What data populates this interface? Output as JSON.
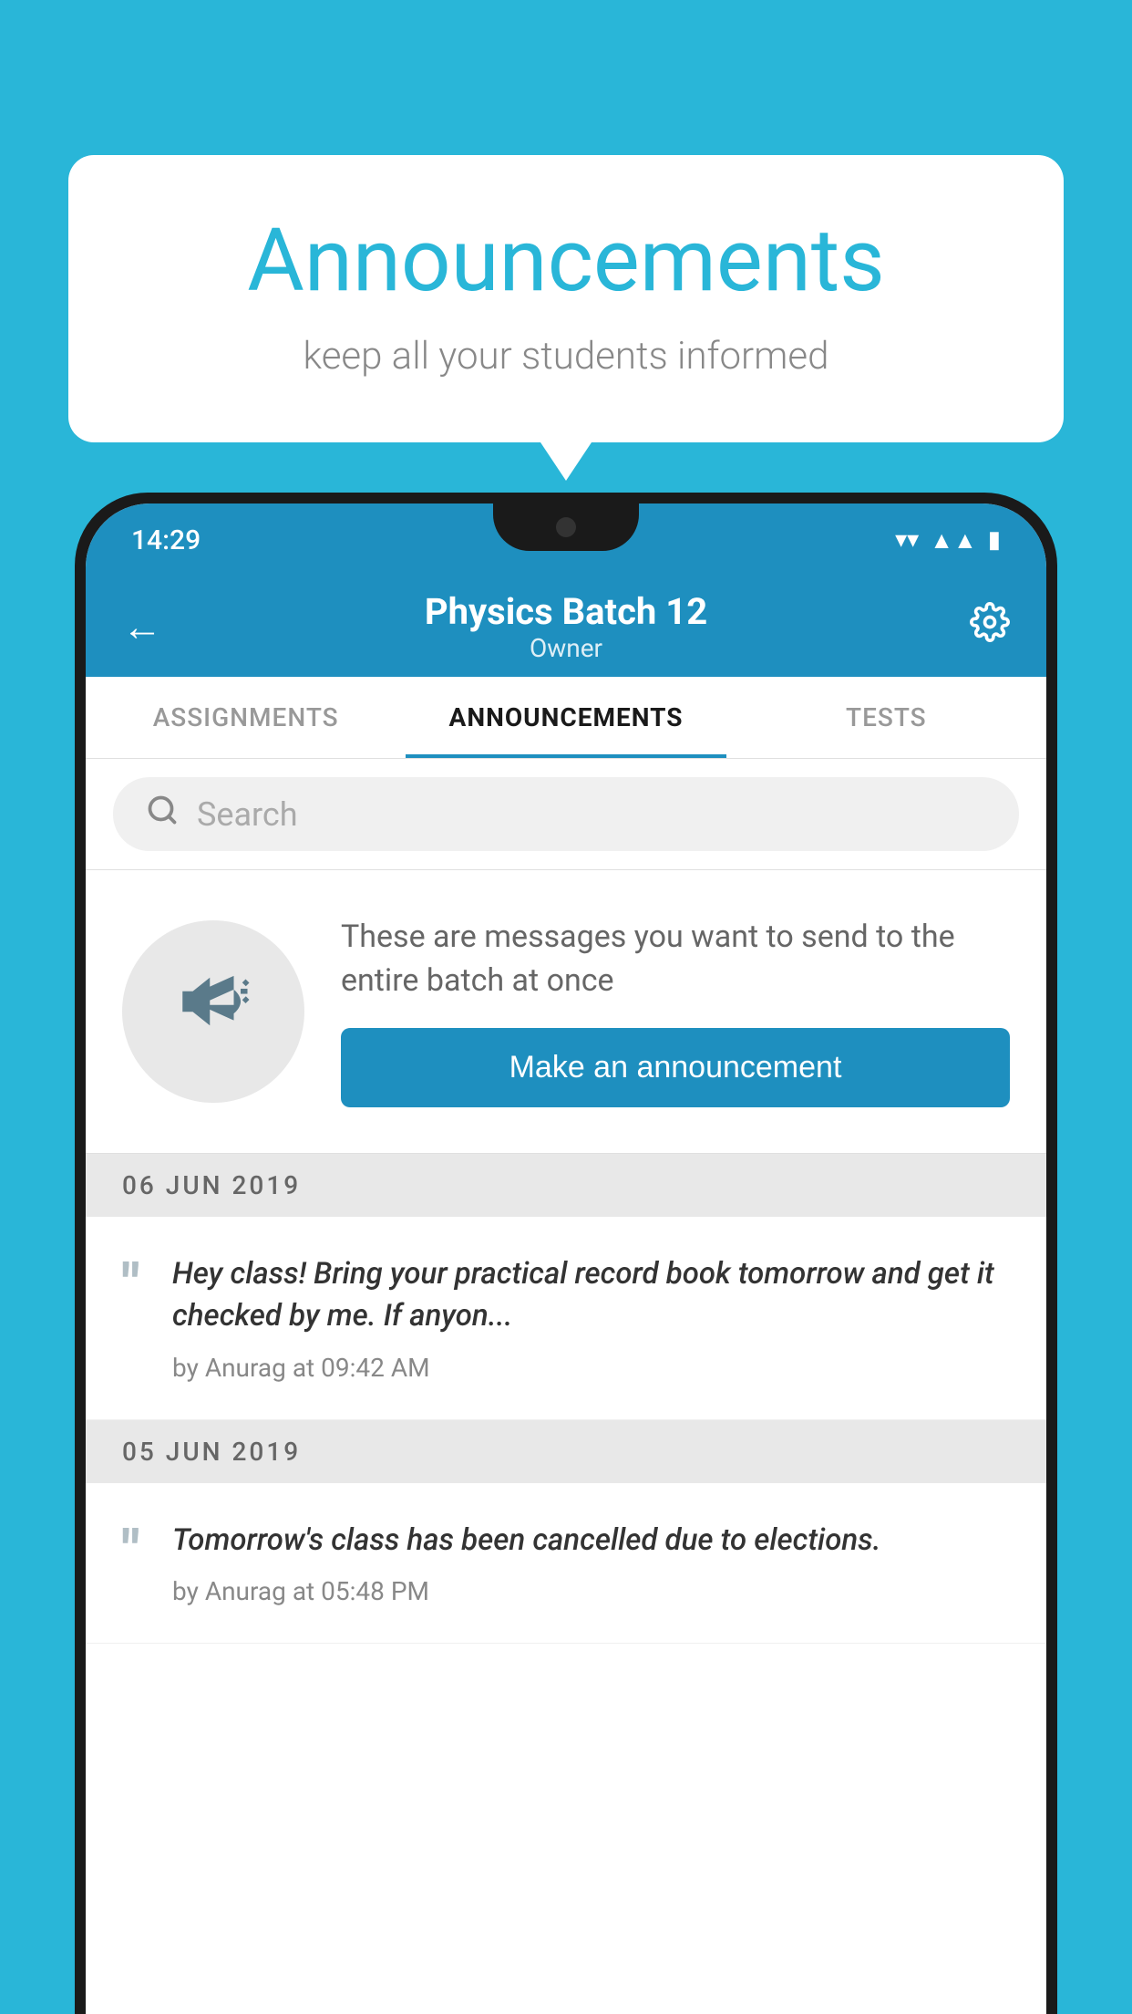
{
  "background_color": "#29B6D8",
  "speech_bubble": {
    "title": "Announcements",
    "subtitle": "keep all your students informed"
  },
  "phone": {
    "status_bar": {
      "time": "14:29",
      "icons": [
        "wifi",
        "signal",
        "battery"
      ]
    },
    "app_bar": {
      "title": "Physics Batch 12",
      "subtitle": "Owner",
      "back_label": "←",
      "settings_label": "⚙"
    },
    "tabs": [
      {
        "label": "ASSIGNMENTS",
        "active": false
      },
      {
        "label": "ANNOUNCEMENTS",
        "active": true
      },
      {
        "label": "TESTS",
        "active": false
      }
    ],
    "search": {
      "placeholder": "Search"
    },
    "announcement_prompt": {
      "description": "These are messages you want to send to the entire batch at once",
      "button_label": "Make an announcement"
    },
    "announcements": [
      {
        "date": "06  JUN  2019",
        "text": "Hey class! Bring your practical record book tomorrow and get it checked by me. If anyon...",
        "meta": "by Anurag at 09:42 AM"
      },
      {
        "date": "05  JUN  2019",
        "text": "Tomorrow's class has been cancelled due to elections.",
        "meta": "by Anurag at 05:48 PM"
      }
    ]
  }
}
